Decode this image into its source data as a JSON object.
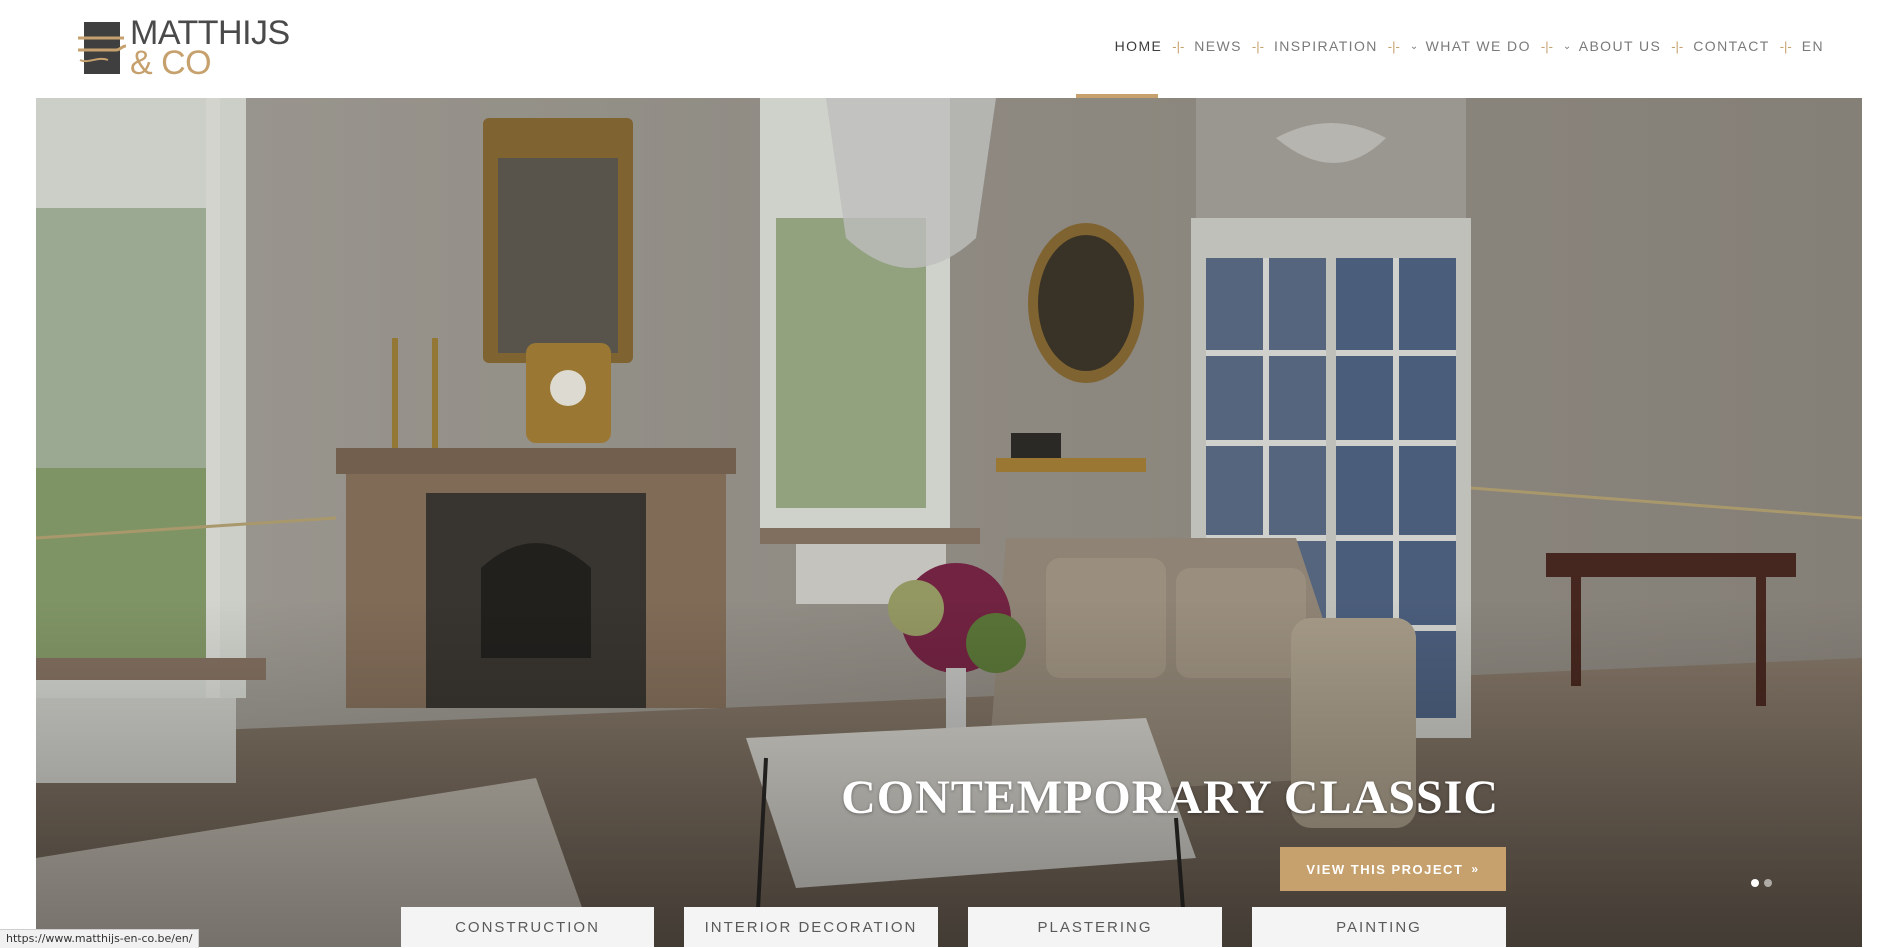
{
  "logo": {
    "line1": "MATTHIJS",
    "line2": "& CO"
  },
  "nav": {
    "items": [
      {
        "label": "HOME",
        "active": true,
        "dropdown": false
      },
      {
        "label": "NEWS",
        "active": false,
        "dropdown": false
      },
      {
        "label": "INSPIRATION",
        "active": false,
        "dropdown": false
      },
      {
        "label": "WHAT WE DO",
        "active": false,
        "dropdown": true
      },
      {
        "label": "ABOUT US",
        "active": false,
        "dropdown": true
      },
      {
        "label": "CONTACT",
        "active": false,
        "dropdown": false
      },
      {
        "label": "EN",
        "active": false,
        "dropdown": false
      }
    ],
    "separator": "-|-"
  },
  "hero": {
    "title": "CONTEMPORARY CLASSIC",
    "cta_label": "VIEW THIS PROJECT",
    "cta_icon": "double-chevron-right",
    "slides_count": 2,
    "active_slide": 1
  },
  "services": [
    "CONSTRUCTION",
    "INTERIOR DECORATION",
    "PLASTERING",
    "PAINTING"
  ],
  "status_bar": {
    "url": "https://www.matthijs-en-co.be/en/"
  },
  "colors": {
    "accent": "#c6a16d",
    "text": "#7a7a7a",
    "dark": "#3c3c3c",
    "tab_bg": "#f4f4f4"
  }
}
